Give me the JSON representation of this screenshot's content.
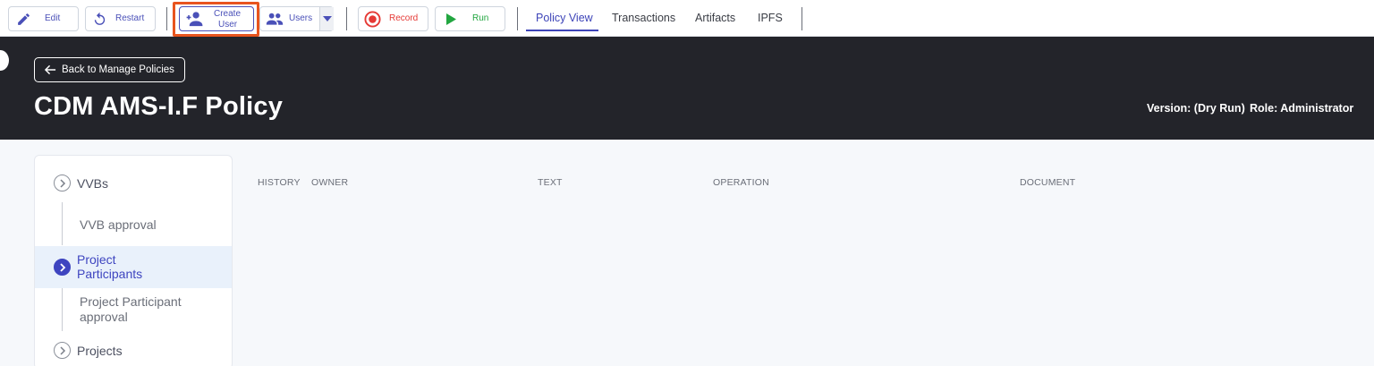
{
  "toolbar": {
    "edit_label": "Edit",
    "restart_label": "Restart",
    "create_user_line1": "Create",
    "create_user_line2": "User",
    "users_label": "Users",
    "record_label": "Record",
    "run_label": "Run",
    "colors": {
      "record": "#e53935",
      "run": "#22a640",
      "accent": "#4a50b8",
      "highlight": "#e8541e"
    }
  },
  "tabs": [
    {
      "label": "Policy View",
      "active": true
    },
    {
      "label": "Transactions",
      "active": false
    },
    {
      "label": "Artifacts",
      "active": false
    },
    {
      "label": "IPFS",
      "active": false
    }
  ],
  "header": {
    "back_label": "Back to Manage Policies",
    "title": "CDM AMS-I.F Policy",
    "version": "Version: (Dry Run)",
    "role": "Role: Administrator"
  },
  "sidebar": {
    "items": [
      {
        "label": "VVBs",
        "expanded": false
      },
      {
        "label": "VVB approval",
        "type": "sub"
      },
      {
        "label": "Project Participants",
        "active": true
      },
      {
        "label": "Project Participant approval",
        "type": "sub"
      },
      {
        "label": "Projects",
        "expanded": false
      }
    ]
  },
  "table": {
    "columns": [
      "HISTORY",
      "OWNER",
      "TEXT",
      "OPERATION",
      "DOCUMENT"
    ]
  }
}
